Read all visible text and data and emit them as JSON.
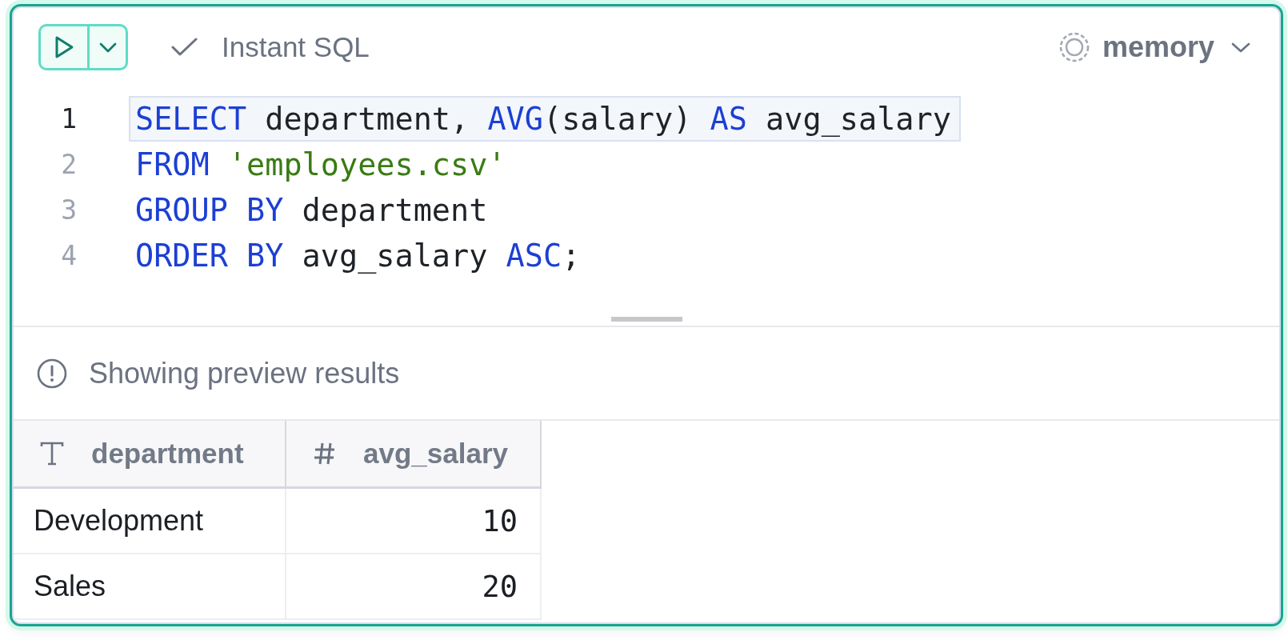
{
  "toolbar": {
    "instant_sql": {
      "label": "Instant SQL",
      "checked": true
    },
    "database": {
      "name": "memory"
    }
  },
  "editor": {
    "lines": [
      {
        "number": "1",
        "active": true,
        "tokens": [
          {
            "kind": "keyword",
            "text": "SELECT"
          },
          {
            "kind": "plain",
            "text": " department, "
          },
          {
            "kind": "keyword",
            "text": "AVG"
          },
          {
            "kind": "plain",
            "text": "(salary) "
          },
          {
            "kind": "keyword",
            "text": "AS"
          },
          {
            "kind": "plain",
            "text": " avg_salary"
          }
        ]
      },
      {
        "number": "2",
        "active": false,
        "tokens": [
          {
            "kind": "keyword",
            "text": "FROM "
          },
          {
            "kind": "string",
            "text": "'employees.csv'"
          }
        ]
      },
      {
        "number": "3",
        "active": false,
        "tokens": [
          {
            "kind": "keyword",
            "text": "GROUP BY"
          },
          {
            "kind": "plain",
            "text": " department"
          }
        ]
      },
      {
        "number": "4",
        "active": false,
        "tokens": [
          {
            "kind": "keyword",
            "text": "ORDER BY"
          },
          {
            "kind": "plain",
            "text": " avg_salary "
          },
          {
            "kind": "keyword",
            "text": "ASC"
          },
          {
            "kind": "plain",
            "text": ";"
          }
        ]
      }
    ]
  },
  "results": {
    "notice": "Showing preview results",
    "columns": [
      {
        "name": "department",
        "kind": "text"
      },
      {
        "name": "avg_salary",
        "kind": "number"
      }
    ],
    "rows": [
      [
        "Development",
        "10"
      ],
      [
        "Sales",
        "20"
      ]
    ]
  }
}
